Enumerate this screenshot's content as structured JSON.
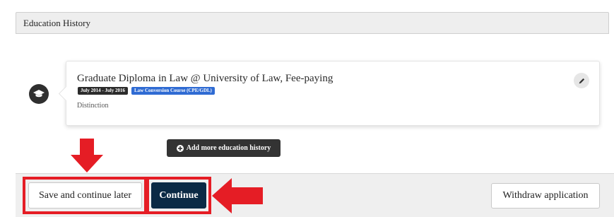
{
  "section": {
    "title": "Education History"
  },
  "education_entry": {
    "title": "Graduate Diploma in Law @ University of Law, Fee-paying",
    "date_tag": "July 2014 - July 2016",
    "course_tag": "Law Conversion Course (CPE/GDL)",
    "grade": "Distinction",
    "badge_icon": "graduation-cap-icon",
    "edit_icon": "pencil-icon"
  },
  "add_more": {
    "icon": "plus-circle-icon",
    "label": "Add more education history"
  },
  "footer": {
    "save_label": "Save and continue later",
    "continue_label": "Continue",
    "withdraw_label": "Withdraw application"
  },
  "colors": {
    "annotation_red": "#e51d25",
    "primary_button": "#0b2a45",
    "course_tag": "#2f6bd3",
    "dark_tag": "#2b2b2b"
  }
}
